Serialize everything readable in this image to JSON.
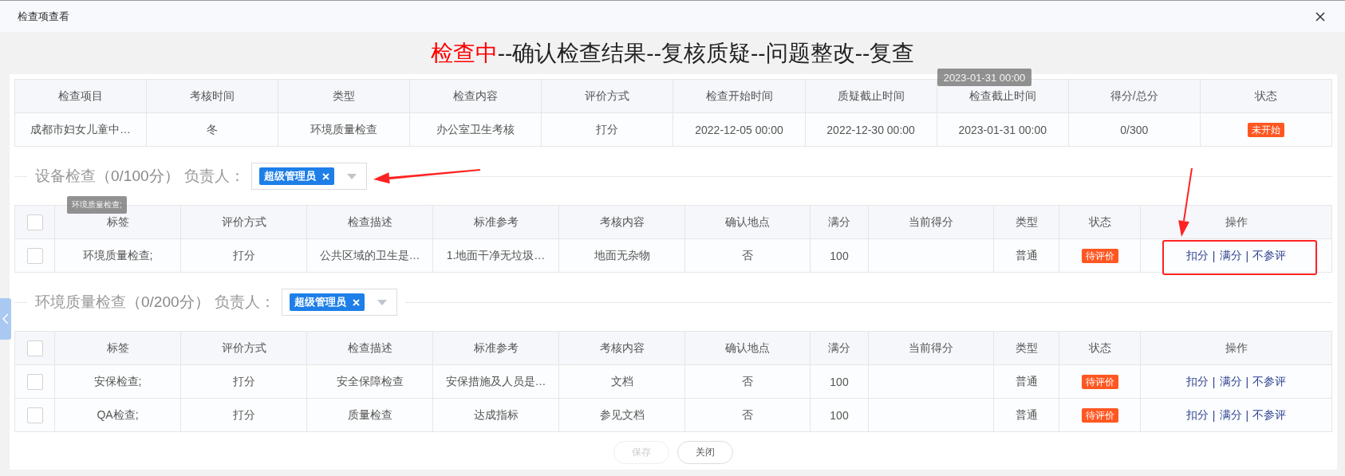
{
  "window": {
    "title": "检查项查看"
  },
  "progress": {
    "separator": "--",
    "steps": [
      {
        "label": "检查中",
        "current": true
      },
      {
        "label": "确认检查结果",
        "current": false
      },
      {
        "label": "复核质疑",
        "current": false
      },
      {
        "label": "问题整改",
        "current": false
      },
      {
        "label": "复查",
        "current": false
      }
    ]
  },
  "info_table": {
    "columns": [
      {
        "label": "检查项目"
      },
      {
        "label": "考核时间"
      },
      {
        "label": "类型"
      },
      {
        "label": "检查内容"
      },
      {
        "label": "评价方式"
      },
      {
        "label": "检查开始时间"
      },
      {
        "label": "质疑截止时间"
      },
      {
        "label": "检查截止时间",
        "tooltip": "2023-01-31 00:00"
      },
      {
        "label": "得分/总分"
      },
      {
        "label": "状态"
      }
    ],
    "row": {
      "cells": [
        "成都市妇女儿童中…",
        "冬",
        "环境质量检查",
        "办公室卫生考核",
        "打分",
        "2022-12-05 00:00",
        "2022-12-30 00:00",
        "2023-01-31 00:00",
        "0/300"
      ],
      "status": "未开始"
    }
  },
  "sections": [
    {
      "title": "设备检查",
      "score": "（0/100分）",
      "owner_label": "负责人：",
      "owners": [
        "超级管理员"
      ],
      "all_checked": false,
      "columns": [
        {
          "label": "标签",
          "tooltip": "环境质量检查;"
        },
        {
          "label": "评价方式"
        },
        {
          "label": "检查描述"
        },
        {
          "label": "标准参考"
        },
        {
          "label": "考核内容"
        },
        {
          "label": "确认地点"
        },
        {
          "label": "满分"
        },
        {
          "label": "当前得分"
        },
        {
          "label": "类型"
        },
        {
          "label": "状态"
        },
        {
          "label": "操作"
        }
      ],
      "rows": [
        {
          "checked": false,
          "cells": [
            "环境质量检查;",
            "打分",
            "公共区域的卫生是…",
            "1.地面干净无垃圾…",
            "地面无杂物",
            "否",
            "100",
            "",
            "普通"
          ],
          "status": "待评价",
          "actions": [
            "扣分",
            "满分",
            "不参评"
          ]
        }
      ]
    },
    {
      "title": "环境质量检查",
      "score": "（0/200分）",
      "owner_label": "负责人：",
      "owners": [
        "超级管理员"
      ],
      "all_checked": false,
      "columns": [
        {
          "label": "标签"
        },
        {
          "label": "评价方式"
        },
        {
          "label": "检查描述"
        },
        {
          "label": "标准参考"
        },
        {
          "label": "考核内容"
        },
        {
          "label": "确认地点"
        },
        {
          "label": "满分"
        },
        {
          "label": "当前得分"
        },
        {
          "label": "类型"
        },
        {
          "label": "状态"
        },
        {
          "label": "操作"
        }
      ],
      "rows": [
        {
          "checked": false,
          "cells": [
            "安保检查;",
            "打分",
            "安全保障检查",
            "安保措施及人员是…",
            "文档",
            "否",
            "100",
            "",
            "普通"
          ],
          "status": "待评价",
          "actions": [
            "扣分",
            "满分",
            "不参评"
          ]
        },
        {
          "checked": false,
          "cells": [
            "QA检查;",
            "打分",
            "质量检查",
            "达成指标",
            "参见文档",
            "否",
            "100",
            "",
            "普通"
          ],
          "status": "待评价",
          "actions": [
            "扣分",
            "满分",
            "不参评"
          ]
        }
      ]
    }
  ],
  "action_separator": "|",
  "buttons": [
    {
      "label": "保存",
      "disabled": true
    },
    {
      "label": "关闭",
      "disabled": false
    }
  ]
}
